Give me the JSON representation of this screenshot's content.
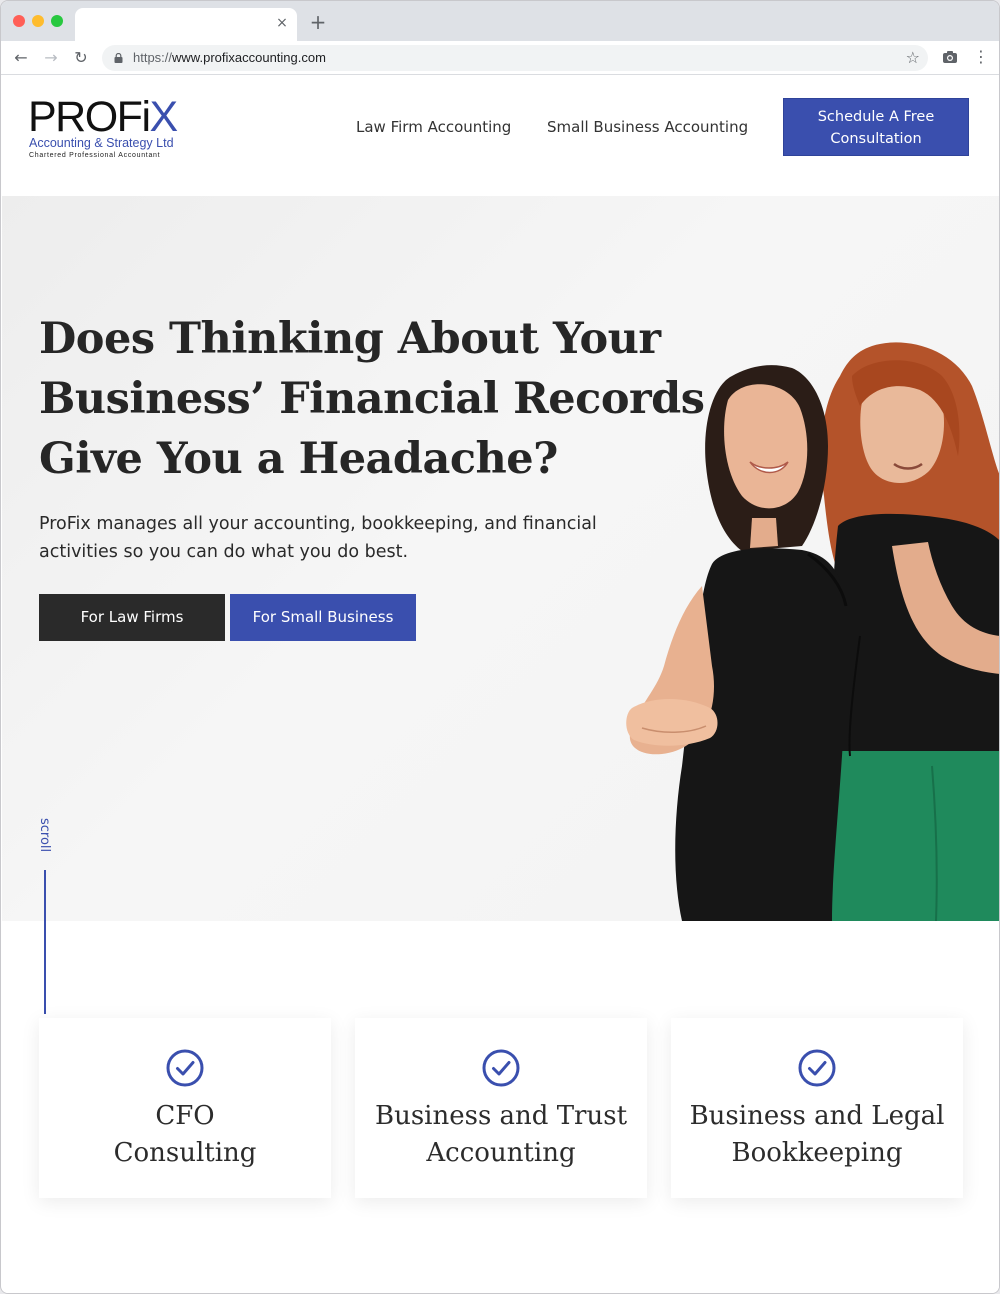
{
  "browser": {
    "url_scheme": "https://",
    "url_host": "www.profixaccounting.com",
    "new_tab_symbol": "+",
    "close_symbol": "×"
  },
  "site": {
    "logo": {
      "wordmark_main": "PROFi",
      "wordmark_accent": "X",
      "subtitle": "Accounting & Strategy Ltd",
      "tagline": "Chartered Professional Accountant"
    },
    "nav": {
      "items": [
        {
          "label": "Law Firm Accounting"
        },
        {
          "label": "Small Business Accounting"
        }
      ],
      "cta_line1": "Schedule A Free",
      "cta_line2": "Consultation"
    },
    "hero": {
      "title": "Does Thinking About Your Business’ Financial Records Give You a Headache?",
      "description": "ProFix manages all your accounting, bookkeeping, and financial activities so you can do what you do best.",
      "buttons": [
        {
          "label": "For Law Firms"
        },
        {
          "label": "For Small Business"
        }
      ],
      "scroll_label": "scroll"
    },
    "services": [
      {
        "line1": "CFO",
        "line2": "Consulting",
        "icon": "check-circle-icon"
      },
      {
        "line1": "Business and Trust",
        "line2": "Accounting",
        "icon": "check-circle-icon"
      },
      {
        "line1": "Business and Legal",
        "line2": "Bookkeeping",
        "icon": "check-circle-icon"
      }
    ]
  },
  "colors": {
    "brand_blue": "#3a4fae",
    "dark_button": "#2a2a2a",
    "hero_background": "#f2f2f2"
  }
}
